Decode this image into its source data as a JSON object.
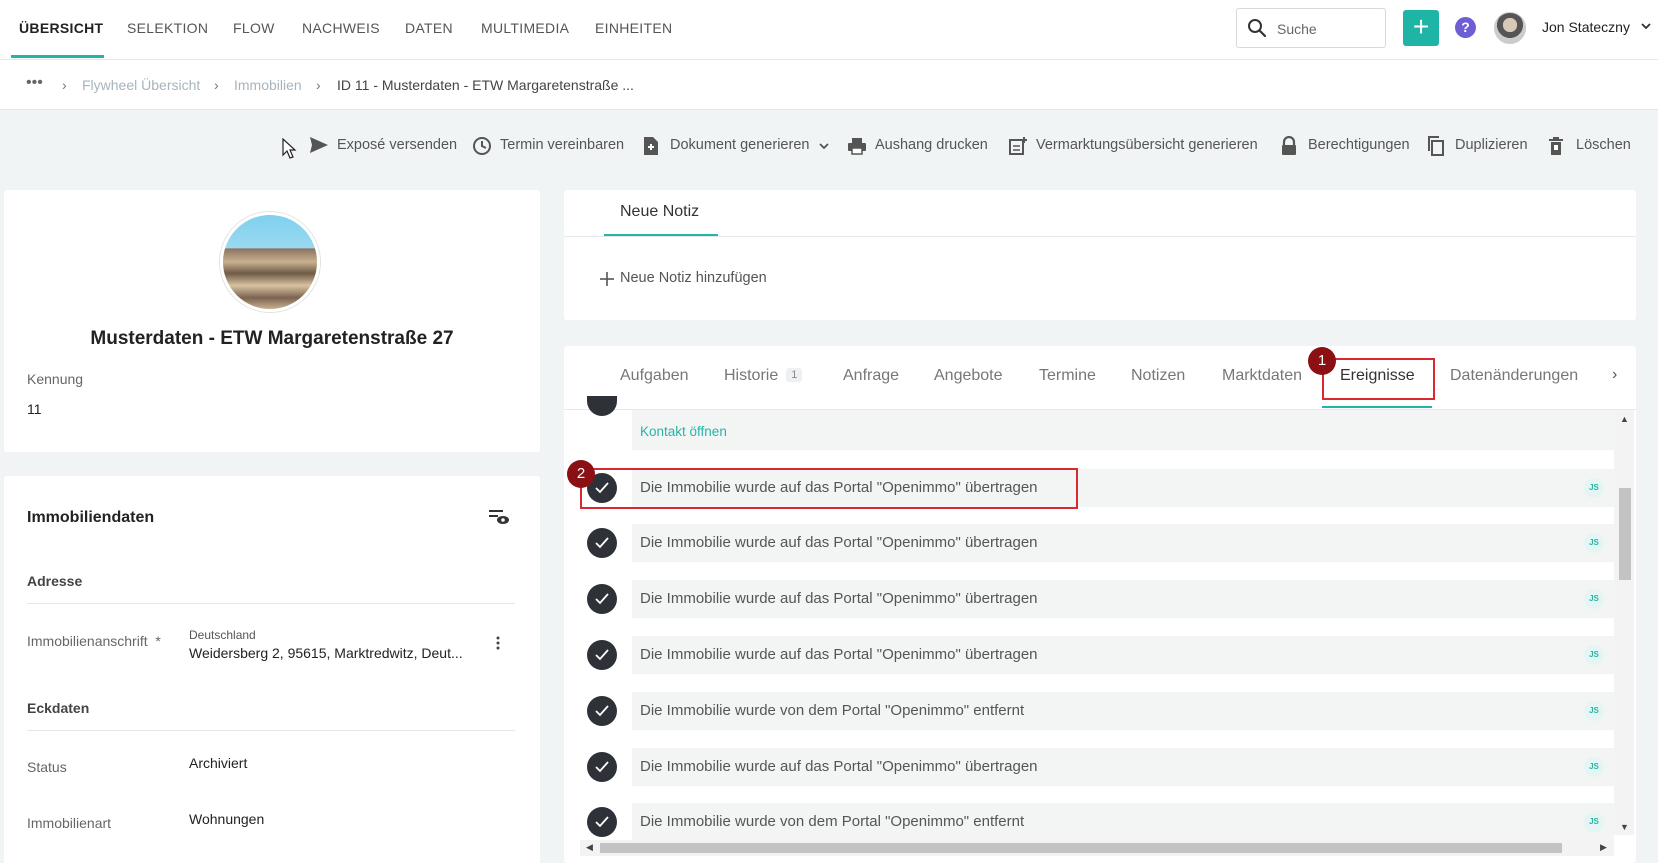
{
  "nav": {
    "items": [
      "ÜBERSICHT",
      "SELEKTION",
      "FLOW",
      "NACHWEIS",
      "DATEN",
      "MULTIMEDIA",
      "EINHEITEN"
    ],
    "search_placeholder": "Suche",
    "add_label": "+",
    "help_label": "?",
    "user_name": "Jon Stateczny"
  },
  "breadcrumb": {
    "more": "•••",
    "sep": "›",
    "items": [
      "Flywheel Übersicht",
      "Immobilien"
    ],
    "current": "ID 11 - Musterdaten - ETW Margaretenstraße ..."
  },
  "actions": [
    {
      "label": "Exposé versenden",
      "icon": "send-icon"
    },
    {
      "label": "Termin vereinbaren",
      "icon": "clock-icon"
    },
    {
      "label": "Dokument generieren",
      "icon": "document-icon"
    },
    {
      "label": "Aushang drucken",
      "icon": "print-icon"
    },
    {
      "label": "Vermarktungsübersicht generieren",
      "icon": "add-document-icon"
    },
    {
      "label": "Berechtigungen",
      "icon": "lock-icon"
    },
    {
      "label": "Duplizieren",
      "icon": "copy-icon"
    },
    {
      "label": "Löschen",
      "icon": "trash-icon"
    }
  ],
  "property": {
    "title": "Musterdaten - ETW Margaretenstraße 27",
    "id_label": "Kennung",
    "id_value": "11"
  },
  "details": {
    "title": "Immobiliendaten",
    "address_section": "Adresse",
    "address_label": "Immobilienanschrift",
    "required_mark": "*",
    "country": "Deutschland",
    "address": "Weidersberg 2, 95615, Marktredwitz, Deut...",
    "key_section": "Eckdaten",
    "status_label": "Status",
    "status_value": "Archiviert",
    "type_label": "Immobilienart",
    "type_value": "Wohnungen"
  },
  "notes": {
    "tab": "Neue Notiz",
    "add_label": "Neue Notiz hinzufügen"
  },
  "tabs": [
    {
      "label": "Aufgaben"
    },
    {
      "label": "Historie",
      "badge": "1"
    },
    {
      "label": "Anfrage"
    },
    {
      "label": "Angebote"
    },
    {
      "label": "Termine"
    },
    {
      "label": "Notizen"
    },
    {
      "label": "Marktdaten"
    },
    {
      "label": "Ereignisse",
      "active": true
    },
    {
      "label": "Datenänderungen"
    }
  ],
  "tabs_more": "›",
  "events": {
    "contact_link": "Kontakt öffnen",
    "items": [
      "Die Immobilie wurde auf das Portal \"Openimmo\" übertragen",
      "Die Immobilie wurde auf das Portal \"Openimmo\" übertragen",
      "Die Immobilie wurde auf das Portal \"Openimmo\" übertragen",
      "Die Immobilie wurde auf das Portal \"Openimmo\" übertragen",
      "Die Immobilie wurde von dem Portal \"Openimmo\" entfernt",
      "Die Immobilie wurde auf das Portal \"Openimmo\" übertragen",
      "Die Immobilie wurde von dem Portal \"Openimmo\" entfernt"
    ],
    "user_badge": "JS"
  },
  "annotations": [
    "1",
    "2"
  ],
  "colors": {
    "accent": "#26b5a5",
    "annotation": "#d9282f",
    "annotation_badge": "#8b1014"
  }
}
